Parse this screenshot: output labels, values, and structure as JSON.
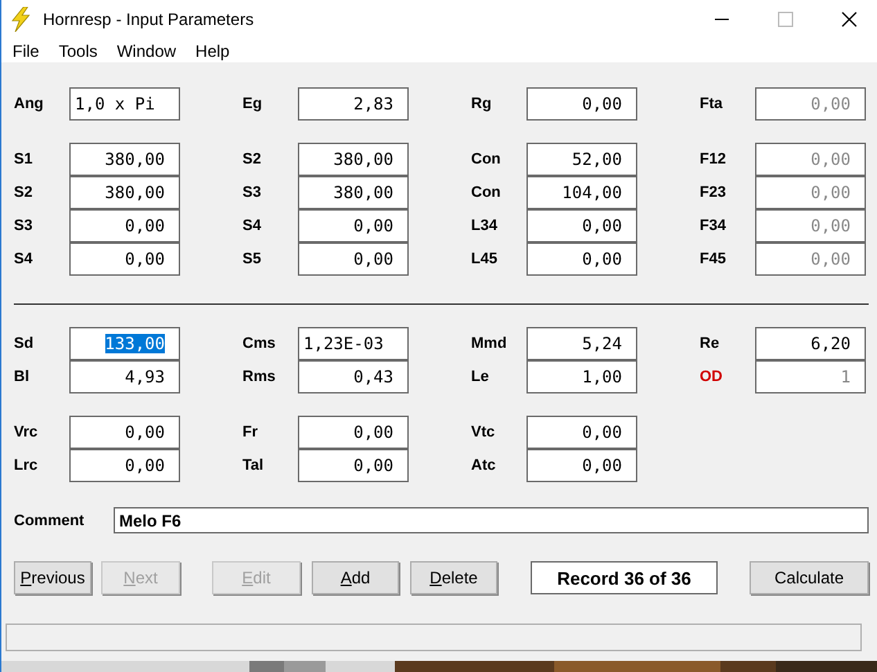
{
  "window": {
    "title": "Hornresp - Input Parameters"
  },
  "menu": [
    "File",
    "Tools",
    "Window",
    "Help"
  ],
  "groups": [
    {
      "rows": [
        [
          {
            "label": "Ang",
            "value": "1,0 x Pi",
            "kind": "text",
            "disabled": false,
            "selected": false,
            "alert": false
          },
          {
            "label": "Eg",
            "value": "2,83",
            "kind": "number",
            "disabled": false,
            "selected": false,
            "alert": false
          },
          {
            "label": "Rg",
            "value": "0,00",
            "kind": "number",
            "disabled": false,
            "selected": false,
            "alert": false
          },
          {
            "label": "Fta",
            "value": "0,00",
            "kind": "number",
            "disabled": true,
            "selected": false,
            "alert": false
          }
        ]
      ]
    },
    {
      "rows": [
        [
          {
            "label": "S1",
            "value": "380,00",
            "kind": "number",
            "disabled": false,
            "selected": false,
            "alert": false
          },
          {
            "label": "S2",
            "value": "380,00",
            "kind": "number",
            "disabled": false,
            "selected": false,
            "alert": false
          },
          {
            "label": "Con",
            "value": "52,00",
            "kind": "number",
            "disabled": false,
            "selected": false,
            "alert": false
          },
          {
            "label": "F12",
            "value": "0,00",
            "kind": "number",
            "disabled": true,
            "selected": false,
            "alert": false
          }
        ],
        [
          {
            "label": "S2",
            "value": "380,00",
            "kind": "number",
            "disabled": false,
            "selected": false,
            "alert": false
          },
          {
            "label": "S3",
            "value": "380,00",
            "kind": "number",
            "disabled": false,
            "selected": false,
            "alert": false
          },
          {
            "label": "Con",
            "value": "104,00",
            "kind": "number",
            "disabled": false,
            "selected": false,
            "alert": false
          },
          {
            "label": "F23",
            "value": "0,00",
            "kind": "number",
            "disabled": true,
            "selected": false,
            "alert": false
          }
        ],
        [
          {
            "label": "S3",
            "value": "0,00",
            "kind": "number",
            "disabled": false,
            "selected": false,
            "alert": false
          },
          {
            "label": "S4",
            "value": "0,00",
            "kind": "number",
            "disabled": false,
            "selected": false,
            "alert": false
          },
          {
            "label": "L34",
            "value": "0,00",
            "kind": "number",
            "disabled": false,
            "selected": false,
            "alert": false
          },
          {
            "label": "F34",
            "value": "0,00",
            "kind": "number",
            "disabled": true,
            "selected": false,
            "alert": false
          }
        ],
        [
          {
            "label": "S4",
            "value": "0,00",
            "kind": "number",
            "disabled": false,
            "selected": false,
            "alert": false
          },
          {
            "label": "S5",
            "value": "0,00",
            "kind": "number",
            "disabled": false,
            "selected": false,
            "alert": false
          },
          {
            "label": "L45",
            "value": "0,00",
            "kind": "number",
            "disabled": false,
            "selected": false,
            "alert": false
          },
          {
            "label": "F45",
            "value": "0,00",
            "kind": "number",
            "disabled": true,
            "selected": false,
            "alert": false
          }
        ]
      ]
    },
    {
      "rows": [
        [
          {
            "label": "Sd",
            "value": "133,00",
            "kind": "number",
            "disabled": false,
            "selected": true,
            "alert": false
          },
          {
            "label": "Cms",
            "value": "1,23E-03",
            "kind": "text",
            "disabled": false,
            "selected": false,
            "alert": false
          },
          {
            "label": "Mmd",
            "value": "5,24",
            "kind": "number",
            "disabled": false,
            "selected": false,
            "alert": false
          },
          {
            "label": "Re",
            "value": "6,20",
            "kind": "number",
            "disabled": false,
            "selected": false,
            "alert": false
          }
        ],
        [
          {
            "label": "Bl",
            "value": "4,93",
            "kind": "number",
            "disabled": false,
            "selected": false,
            "alert": false
          },
          {
            "label": "Rms",
            "value": "0,43",
            "kind": "number",
            "disabled": false,
            "selected": false,
            "alert": false
          },
          {
            "label": "Le",
            "value": "1,00",
            "kind": "number",
            "disabled": false,
            "selected": false,
            "alert": false
          },
          {
            "label": "OD",
            "value": "1",
            "kind": "number",
            "disabled": true,
            "selected": false,
            "alert": true
          }
        ]
      ]
    },
    {
      "rows": [
        [
          {
            "label": "Vrc",
            "value": "0,00",
            "kind": "number",
            "disabled": false,
            "selected": false,
            "alert": false
          },
          {
            "label": "Fr",
            "value": "0,00",
            "kind": "number",
            "disabled": false,
            "selected": false,
            "alert": false
          },
          {
            "label": "Vtc",
            "value": "0,00",
            "kind": "number",
            "disabled": false,
            "selected": false,
            "alert": false
          }
        ],
        [
          {
            "label": "Lrc",
            "value": "0,00",
            "kind": "number",
            "disabled": false,
            "selected": false,
            "alert": false
          },
          {
            "label": "Tal",
            "value": "0,00",
            "kind": "number",
            "disabled": false,
            "selected": false,
            "alert": false
          },
          {
            "label": "Atc",
            "value": "0,00",
            "kind": "number",
            "disabled": false,
            "selected": false,
            "alert": false
          }
        ]
      ]
    }
  ],
  "comment": {
    "label": "Comment",
    "value": "Melo F6"
  },
  "buttons": [
    {
      "label": "Previous",
      "kind": "button",
      "disabled": false,
      "access_key": true
    },
    {
      "label": "Next",
      "kind": "button",
      "disabled": true,
      "access_key": true
    },
    {
      "label": "Edit",
      "kind": "button",
      "disabled": true,
      "access_key": true
    },
    {
      "label": "Add",
      "kind": "button",
      "disabled": false,
      "access_key": true
    },
    {
      "label": "Delete",
      "kind": "button",
      "disabled": false,
      "access_key": true
    },
    {
      "label": "Record 36 of 36",
      "kind": "display"
    },
    {
      "label": "Calculate",
      "kind": "button",
      "disabled": false,
      "access_key": false
    }
  ]
}
